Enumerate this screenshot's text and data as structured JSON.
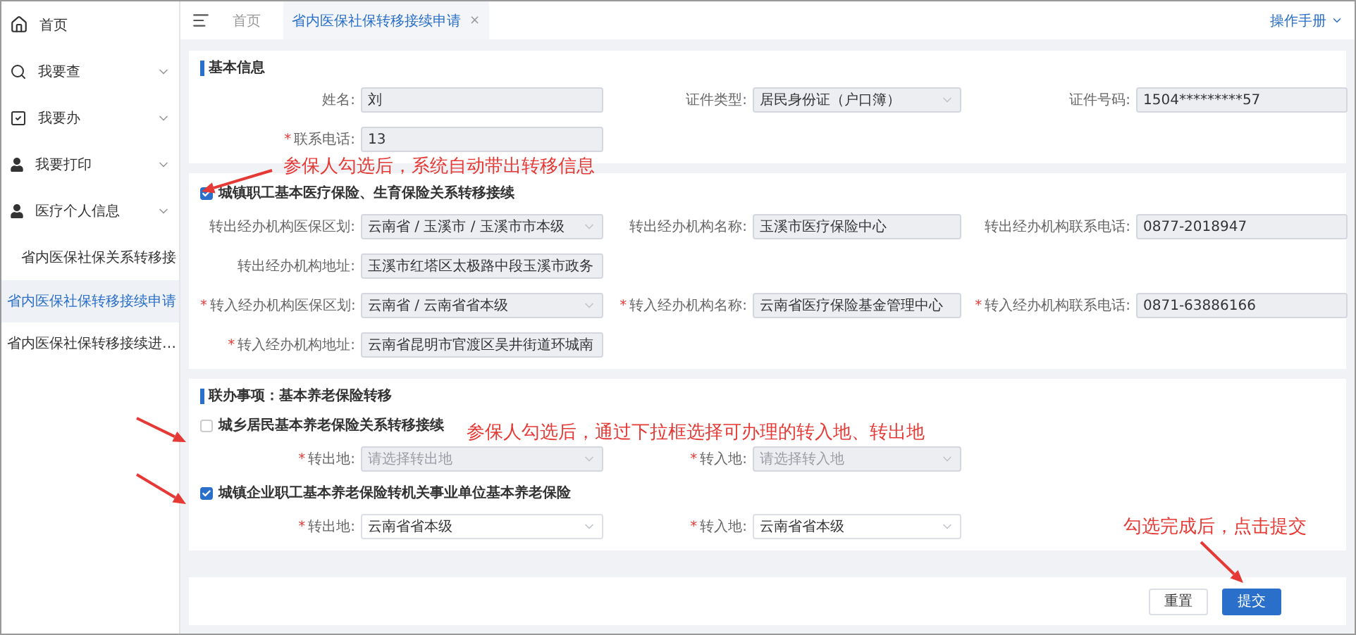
{
  "sidebar": {
    "items": [
      {
        "label": "首页"
      },
      {
        "label": "我要查",
        "expanded": false
      },
      {
        "label": "我要办",
        "expanded": false
      },
      {
        "label": "我要打印",
        "expanded": false
      },
      {
        "label": "医疗个人信息",
        "expanded": false
      },
      {
        "label": "省内医保社保关系转移接",
        "expanded": true,
        "children": [
          {
            "label": "省内医保社保转移接续申请",
            "selected": true
          },
          {
            "label": "省内医保社保转移接续进…",
            "selected": false
          }
        ]
      }
    ]
  },
  "tabs": [
    {
      "label": "首页",
      "selected": false
    },
    {
      "label": "省内医保社保转移接续申请",
      "selected": true,
      "close": "×"
    }
  ],
  "manual_link": "操作手册",
  "sections": [
    {
      "title": "基本信息",
      "groups": [
        {
          "rows": [
            [
              {
                "label": "姓名:",
                "kind": "input",
                "value": "刘",
                "disabled": true
              },
              {
                "label": "证件类型:",
                "kind": "select",
                "value": "居民身份证（户口簿）",
                "disabled": true
              },
              {
                "label": "证件号码:",
                "kind": "input",
                "value": "1504*********57",
                "disabled": true
              }
            ],
            [
              {
                "label": "联系电话:",
                "kind": "input",
                "value": "13",
                "disabled": true,
                "mark": "*"
              }
            ]
          ]
        }
      ]
    },
    {
      "groups": [
        {
          "checkbox": {
            "label": "城镇职工基本医疗保险、生育保险关系转移接续",
            "checked": true
          },
          "rows": [
            [
              {
                "label": "转出经办机构医保区划:",
                "kind": "select",
                "value": "云南省 / 玉溪市 / 玉溪市市本级",
                "disabled": true
              },
              {
                "label": "转出经办机构名称:",
                "kind": "input",
                "value": "玉溪市医疗保险中心",
                "disabled": true
              },
              {
                "label": "转出经办机构联系电话:",
                "kind": "input",
                "value": "0877-2018947",
                "disabled": true
              }
            ],
            [
              {
                "label": "转出经办机构地址:",
                "kind": "input",
                "value": "玉溪市红塔区太极路中段玉溪市政务",
                "disabled": true
              }
            ],
            [
              {
                "label": "转入经办机构医保区划:",
                "kind": "select",
                "value": "云南省 / 云南省省本级",
                "disabled": true,
                "mark": "*"
              },
              {
                "label": "转入经办机构名称:",
                "kind": "input",
                "value": "云南省医疗保险基金管理中心",
                "disabled": true,
                "mark": "*"
              },
              {
                "label": "转入经办机构联系电话:",
                "kind": "input",
                "value": "0871-63886166",
                "disabled": true,
                "mark": "*"
              }
            ],
            [
              {
                "label": "转入经办机构地址:",
                "kind": "input",
                "value": "云南省昆明市官渡区吴井街道环城南",
                "disabled": true,
                "mark": "*"
              }
            ]
          ]
        }
      ]
    },
    {
      "title": "联办事项：基本养老保险转移",
      "groups": [
        {
          "checkbox": {
            "label": "城乡居民基本养老保险关系转移接续",
            "checked": false
          },
          "rows": [
            [
              {
                "label": "转出地:",
                "kind": "select",
                "placeholder": "请选择转出地",
                "disabled": true,
                "mark": "*"
              },
              {
                "label": "转入地:",
                "kind": "select",
                "placeholder": "请选择转入地",
                "disabled": true,
                "mark": "*"
              }
            ]
          ]
        },
        {
          "checkbox": {
            "label": "城镇企业职工基本养老保险转机关事业单位基本养老保险",
            "checked": true
          },
          "rows": [
            [
              {
                "label": "转出地:",
                "kind": "select",
                "value": "云南省省本级",
                "disabled": false,
                "mark": "*"
              },
              {
                "label": "转入地:",
                "kind": "select",
                "value": "云南省省本级",
                "disabled": false,
                "mark": "*"
              }
            ]
          ]
        }
      ]
    }
  ],
  "buttons": [
    {
      "label": "重置",
      "kind": "default"
    },
    {
      "label": "提交",
      "kind": "primary"
    }
  ],
  "annotations": [
    {
      "text": "参保人勾选后，系统自动带出转移信息"
    },
    {
      "text": "参保人勾选后，通过下拉框选择可办理的转入地、转出地"
    },
    {
      "text": "勾选完成后，点击提交"
    }
  ]
}
